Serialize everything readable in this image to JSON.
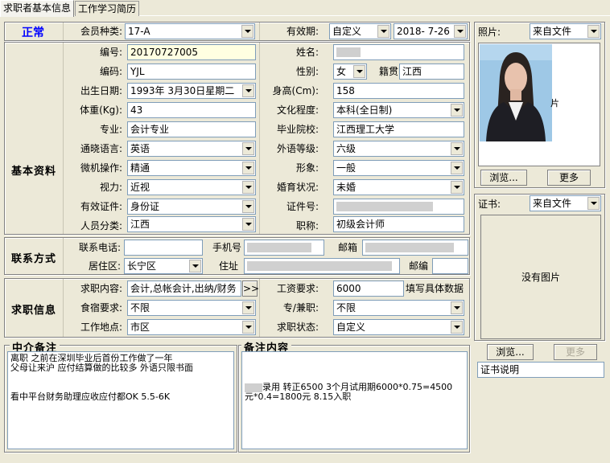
{
  "tabs": [
    {
      "label": "求职者基本信息"
    },
    {
      "label": "工作学习简历"
    }
  ],
  "status": {
    "text": "正常",
    "color": "#0000ff"
  },
  "member": {
    "label": "会员种类:",
    "value": "17-A"
  },
  "validity": {
    "label": "有效期:",
    "type": "自定义",
    "date": "2018- 7-26"
  },
  "sections": {
    "basic": "基本资料",
    "contact": "联系方式",
    "job": "求职信息",
    "agency_note": "中介备注",
    "remark": "备注内容"
  },
  "basic": {
    "serial": {
      "label": "编号:",
      "value": "20170727005"
    },
    "name": {
      "label": "姓名:",
      "value": ""
    },
    "code": {
      "label": "编码:",
      "value": "YJL"
    },
    "gender": {
      "label": "性别:",
      "value": "女"
    },
    "native": {
      "label": "籍贯",
      "value": "江西"
    },
    "birth": {
      "label": "出生日期:",
      "value": "1993年 3月30日星期二"
    },
    "height": {
      "label": "身高(Cm):",
      "value": "158"
    },
    "weight": {
      "label": "体重(Kg):",
      "value": "43"
    },
    "education": {
      "label": "文化程度:",
      "value": "本科(全日制)"
    },
    "major": {
      "label": "专业:",
      "value": "会计专业"
    },
    "school": {
      "label": "毕业院校:",
      "value": "江西理工大学"
    },
    "language": {
      "label": "通晓语言:",
      "value": "英语"
    },
    "fl_level": {
      "label": "外语等级:",
      "value": "六级"
    },
    "computer": {
      "label": "微机操作:",
      "value": "精通"
    },
    "image": {
      "label": "形象:",
      "value": "一般"
    },
    "vision": {
      "label": "视力:",
      "value": "近视"
    },
    "marital": {
      "label": "婚育状况:",
      "value": "未婚"
    },
    "id_type": {
      "label": "有效证件:",
      "value": "身份证"
    },
    "id_no": {
      "label": "证件号:",
      "value": ""
    },
    "category": {
      "label": "人员分类:",
      "value": "江西"
    },
    "title": {
      "label": "职称:",
      "value": "初级会计师"
    }
  },
  "contact": {
    "phone": {
      "label": "联系电话:",
      "value": ""
    },
    "mobile": {
      "label": "手机号",
      "value": ""
    },
    "email": {
      "label": "邮箱",
      "value": ""
    },
    "district": {
      "label": "居住区:",
      "value": "长宁区"
    },
    "address": {
      "label": "住址",
      "value": ""
    },
    "postcode": {
      "label": "邮编",
      "value": ""
    }
  },
  "job": {
    "content": {
      "label": "求职内容:",
      "value": "会计,总帐会计,出纳/财务",
      "more": ">>"
    },
    "salary": {
      "label": "工资要求:",
      "value": "6000",
      "hint": "填写具体数据"
    },
    "board": {
      "label": "食宿要求:",
      "value": "不限"
    },
    "fulltime": {
      "label": "专/兼职:",
      "value": "不限"
    },
    "location": {
      "label": "工作地点:",
      "value": "市区"
    },
    "state": {
      "label": "求职状态:",
      "value": "自定义"
    }
  },
  "notes": {
    "agency_text": "离职 之前在深圳毕业后首份工作做了一年\n父母让来沪 应付结算做的比较多 外语只限书面\n\n\n看中平台财务助理应收应付都OK 5.5-6K",
    "remark_text": "录用 转正6500 3个月试用期6000*0.75=4500\n元*0.4=1800元 8.15入职"
  },
  "photo_panel": {
    "label": "照片:",
    "source": "来自文件",
    "browse": "浏览...",
    "more": "更多"
  },
  "cert_panel": {
    "label": "证书:",
    "source": "来自文件",
    "no_image": "没有图片",
    "browse": "浏览...",
    "more": "更多",
    "desc": "证书说明"
  }
}
